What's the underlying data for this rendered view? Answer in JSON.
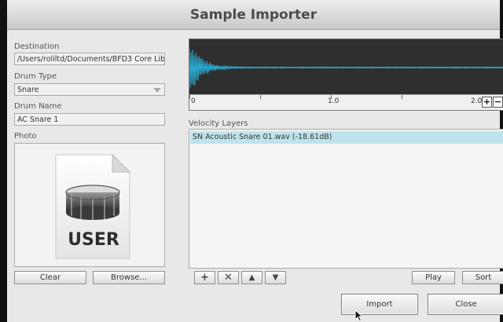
{
  "window": {
    "title": "Sample Importer"
  },
  "left": {
    "destination_label": "Destination",
    "destination_value": "/Users/roliltd/Documents/BFD3 Core Lib",
    "drum_type_label": "Drum Type",
    "drum_type_value": "Snare",
    "drum_name_label": "Drum Name",
    "drum_name_value": "AC Snare 1",
    "photo_label": "Photo",
    "photo_badge": "USER",
    "clear_label": "Clear",
    "browse_label": "Browse..."
  },
  "waveform": {
    "ruler_start": "0",
    "ruler_mid": "1.0",
    "ruler_end": "2.0",
    "zoom_in": "+",
    "zoom_out": "−",
    "wave_color": "#2aa8cf"
  },
  "layers": {
    "label": "Velocity Layers",
    "items": [
      "SN Acoustic Snare 01.wav  (-18.61dB)"
    ],
    "selected_color": "#bfe3ec"
  },
  "layer_tools": {
    "add": "+",
    "remove": "✕",
    "up": "▲",
    "down": "▼",
    "play_label": "Play",
    "sort_label": "Sort"
  },
  "footer": {
    "import_label": "Import",
    "close_label": "Close"
  }
}
